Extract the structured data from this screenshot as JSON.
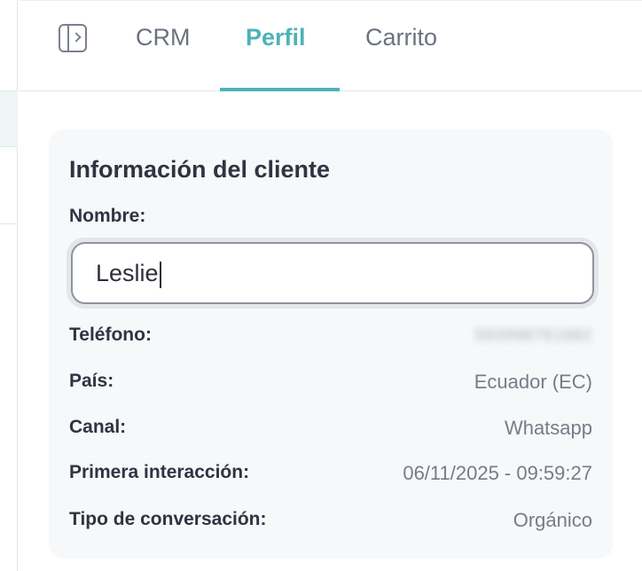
{
  "tabs": {
    "items": [
      {
        "label": "CRM"
      },
      {
        "label": "Perfil"
      },
      {
        "label": "Carrito"
      }
    ],
    "active": "Perfil",
    "toggle_icon": "sidebar-toggle-icon"
  },
  "customer": {
    "title": "Información del cliente",
    "name_label": "Nombre:",
    "name_value": "Leslie",
    "fields": [
      {
        "label": "Teléfono:",
        "value": "593998761682"
      },
      {
        "label": "País:",
        "value": "Ecuador (EC)"
      },
      {
        "label": "Canal:",
        "value": "Whatsapp"
      },
      {
        "label": "Primera interacción:",
        "value": "06/11/2025 - 09:59:27"
      },
      {
        "label": "Tipo de conversación:",
        "value": "Orgánico"
      }
    ]
  },
  "colors": {
    "accent": "#4cb3b8",
    "card_bg": "#f7f8fa",
    "muted_text": "#767c88"
  }
}
